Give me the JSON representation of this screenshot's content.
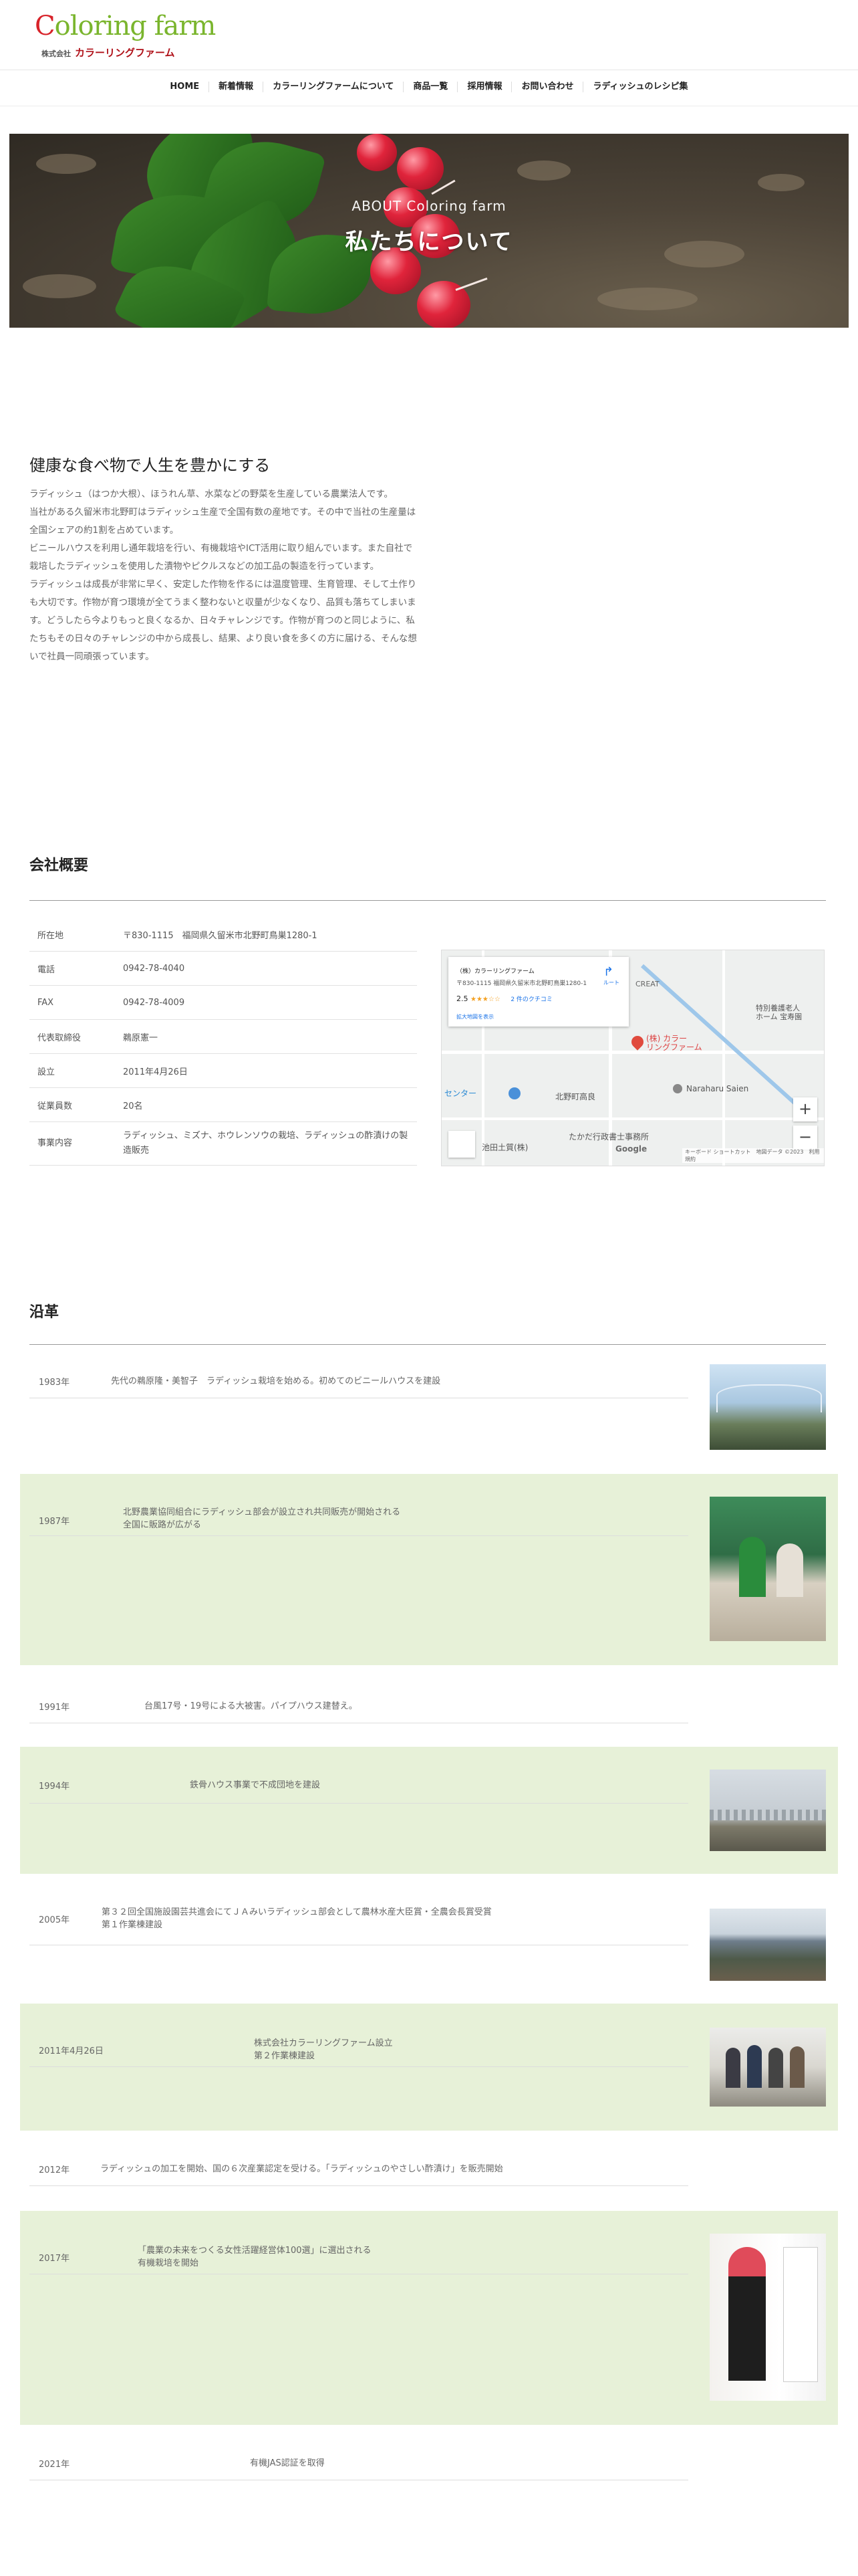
{
  "header": {
    "logo_main": "Coloring farm",
    "logo_prefix": "株式会社",
    "logo_sub": "カラーリングファーム"
  },
  "nav": [
    {
      "label": "HOME"
    },
    {
      "label": "新着情報"
    },
    {
      "label": "カラーリングファームについて"
    },
    {
      "label": "商品一覧"
    },
    {
      "label": "採用情報"
    },
    {
      "label": "お問い合わせ"
    },
    {
      "label": "ラディッシュのレシピ集"
    }
  ],
  "hero": {
    "subtitle": "ABOUT Coloring farm",
    "title": "私たちについて"
  },
  "intro": {
    "title": "健康な食べ物で人生を豊かにする",
    "paragraphs": [
      "ラディッシュ（はつか大根）、ほうれん草、水菜などの野菜を生産している農業法人です。",
      "当社がある久留米市北野町はラディッシュ生産で全国有数の産地です。その中で当社の生産量は全国シェアの約1割を占めています。",
      "ビニールハウスを利用し通年栽培を行い、有機栽培やICT活用に取り組んでいます。また自社で栽培したラディッシュを使用した漬物やピクルスなどの加工品の製造を行っています。",
      "ラディッシュは成長が非常に早く、安定した作物を作るには温度管理、生育管理、そして土作りも大切です。作物が育つ環境が全てうまく整わないと収量が少なくなり、品質も落ちてしまいます。どうしたら今よりもっと良くなるか、日々チャレンジです。作物が育つのと同じように、私たちもその日々のチャレンジの中から成長し、結果、より良い食を多くの方に届ける、そんな想いで社員一同頑張っています。"
    ]
  },
  "company": {
    "title": "会社概要",
    "rows": [
      {
        "key": "所在地",
        "value": "〒830-1115　福岡県久留米市北野町鳥巣1280-1"
      },
      {
        "key": "電話",
        "value": "0942-78-4040"
      },
      {
        "key": "FAX",
        "value": "0942-78-4009"
      },
      {
        "key": "代表取締役",
        "value": "鵜原憲一"
      },
      {
        "key": "設立",
        "value": "2011年4月26日"
      },
      {
        "key": "従業員数",
        "value": "20名"
      },
      {
        "key": "事業内容",
        "value": "ラディッシュ、ミズナ、ホウレンソウの栽培、ラディッシュの酢漬けの製造販売"
      }
    ]
  },
  "map": {
    "card_title": "（株）カラーリングファーム",
    "card_address": "〒830-1115 福岡県久留米市北野町鳥巣1280-1",
    "rating": "2.5",
    "stars": "★★★☆☆",
    "reviews": "2 件のクチコミ",
    "larger_map": "拡大地図を表示",
    "directions": "ルート",
    "label_creat": "CREAT",
    "label_center": "センター",
    "label_kitano": "北野町高良",
    "label_naraharu": "Naraharu Saien",
    "label_pin": "(株) カラー\nリングファーム",
    "label_home": "特別養護老人\nホーム 宝寿園",
    "label_ikeda": "池田土質(株)",
    "label_takata": "たかだ行政書士事務所",
    "google": "Google",
    "footer": "キーボード ショートカット　地図データ ©2023　利用規約",
    "zoom_in": "+",
    "zoom_out": "−"
  },
  "history": {
    "title": "沿革",
    "items": [
      {
        "year": "1983年",
        "text": "先代の鵜原隆・美智子　ラディッシュ栽培を始める。初めてのビニールハウスを建設"
      },
      {
        "year": "1987年",
        "text": "北野農業協同組合にラディッシュ部会が設立され共同販売が開始される\n全国に販路が広がる"
      },
      {
        "year": "1991年",
        "text": "台風17号・19号による大被害。パイプハウス建替え。"
      },
      {
        "year": "1994年",
        "text": "鉄骨ハウス事業で不成団地を建設"
      },
      {
        "year": "2005年",
        "text": "第３２回全国施設園芸共進会にてＪＡみいラディッシュ部会として農林水産大臣賞・全農会長賞受賞\n第１作業棟建設"
      },
      {
        "year": "2011年4月26日",
        "text": "株式会社カラーリングファーム設立\n第２作業棟建設"
      },
      {
        "year": "2012年",
        "text": "ラディッシュの加工を開始、国の６次産業認定を受ける。「ラディッシュのやさしい酢漬け」を販売開始"
      },
      {
        "year": "2017年",
        "text": "「農業の未来をつくる女性活躍経営体100選」に選出される\n有機栽培を開始"
      },
      {
        "year": "2021年",
        "text": "有機JAS認証を取得"
      }
    ]
  },
  "colors": {
    "accent_green": "#7ab52d",
    "accent_red": "#d8232a",
    "band": "#e7f1d8"
  }
}
